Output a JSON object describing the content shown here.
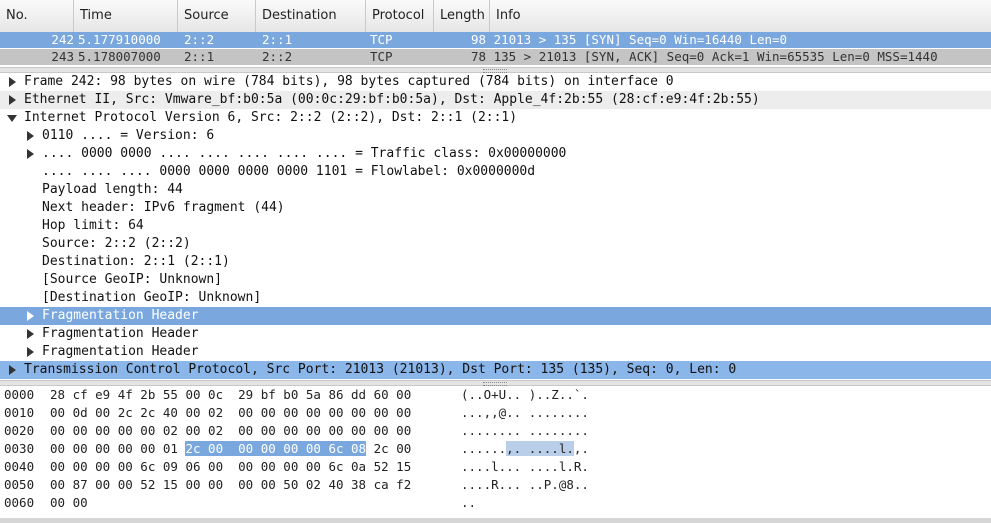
{
  "packet_list": {
    "columns": [
      "No.",
      "Time",
      "Source",
      "Destination",
      "Protocol",
      "Length",
      "Info"
    ],
    "rows": [
      {
        "no": "242",
        "time": "5.177910000",
        "source": "2::2",
        "destination": "2::1",
        "protocol": "TCP",
        "info": "98 21013 > 135 [SYN] Seq=0 Win=16440 Len=0"
      },
      {
        "no": "243",
        "time": "5.178007000",
        "source": "2::1",
        "destination": "2::2",
        "protocol": "TCP",
        "info": "78 135 > 21013 [SYN, ACK] Seq=0 Ack=1 Win=65535 Len=0 MSS=1440"
      }
    ]
  },
  "details": [
    "Frame 242: 98 bytes on wire (784 bits), 98 bytes captured (784 bits) on interface 0",
    "Ethernet II, Src: Vmware_bf:b0:5a (00:0c:29:bf:b0:5a), Dst: Apple_4f:2b:55 (28:cf:e9:4f:2b:55)",
    "Internet Protocol Version 6, Src: 2::2 (2::2), Dst: 2::1 (2::1)",
    "0110 .... = Version: 6",
    ".... 0000 0000 .... .... .... .... .... = Traffic class: 0x00000000",
    ".... .... .... 0000 0000 0000 0000 1101 = Flowlabel: 0x0000000d",
    "Payload length: 44",
    "Next header: IPv6 fragment (44)",
    "Hop limit: 64",
    "Source: 2::2 (2::2)",
    "Destination: 2::1 (2::1)",
    "[Source GeoIP: Unknown]",
    "[Destination GeoIP: Unknown]",
    "Fragmentation Header",
    "Fragmentation Header",
    "Fragmentation Header",
    "Transmission Control Protocol, Src Port: 21013 (21013), Dst Port: 135 (135), Seq: 0, Len: 0"
  ],
  "bytes": {
    "rows": [
      {
        "offset": "0000",
        "hex": "28 cf e9 4f 2b 55 00 0c  29 bf b0 5a 86 dd 60 00",
        "ascii": "(..O+U.. )..Z..`."
      },
      {
        "offset": "0010",
        "hex": "00 0d 00 2c 2c 40 00 02  00 00 00 00 00 00 00 00",
        "ascii": "...,,@.. ........"
      },
      {
        "offset": "0020",
        "hex": "00 00 00 00 00 02 00 02  00 00 00 00 00 00 00 00",
        "ascii": "........ ........"
      },
      {
        "offset": "0030",
        "hex_pre": "00 00 00 00 00 01 ",
        "hex_hl": "2c 00  00 00 00 00 6c 08",
        "hex_post": " 2c 00",
        "ascii_pre": "......",
        "ascii_hl": ",. ....l.",
        "ascii_post": ",."
      },
      {
        "offset": "0040",
        "hex": "00 00 00 00 6c 09 06 00  00 00 00 00 6c 0a 52 15",
        "ascii": "....l... ....l.R."
      },
      {
        "offset": "0050",
        "hex": "00 87 00 00 52 15 00 00  00 00 50 02 40 38 ca f2",
        "ascii": "....R... ..P.@8.."
      },
      {
        "offset": "0060",
        "hex": "00 00",
        "ascii": ".."
      }
    ]
  },
  "colors": {
    "selected_row": "#7aa8de",
    "secondary_row": "#c4c4c4",
    "tree_alt_row": "#ededed"
  }
}
